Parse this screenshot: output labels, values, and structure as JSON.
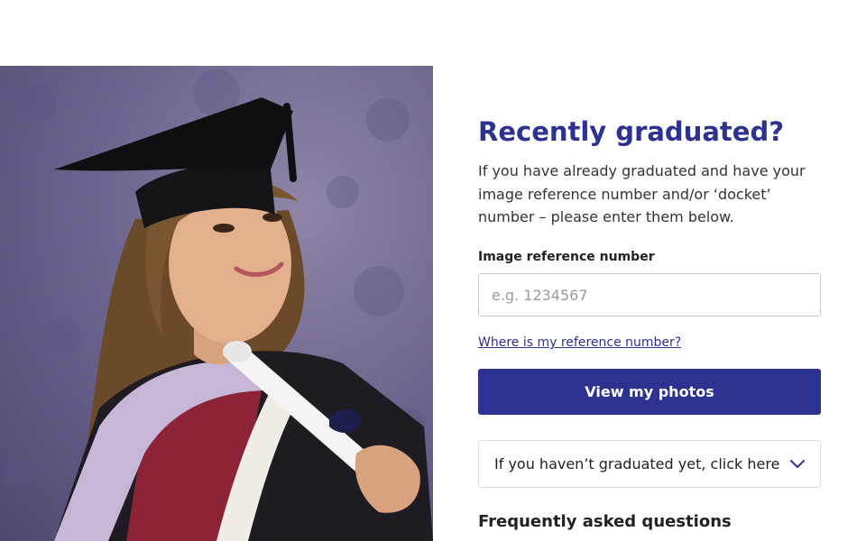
{
  "hero": {
    "image_alt": "Graduate in cap and gown holding a scroll"
  },
  "panel": {
    "title": "Recently graduated?",
    "intro": "If you have already graduated and have your image reference number and/or ‘docket’ number – please enter them below.",
    "field_label": "Image reference number",
    "field_value": "",
    "field_placeholder": "e.g. 1234567",
    "help_link": "Where is my reference number?",
    "submit_label": "View my photos",
    "accordion_label": "If you haven’t graduated yet, click here",
    "accordion_icon": "chevron-down-icon",
    "faq_heading": "Frequently asked questions"
  },
  "colors": {
    "brand": "#2d3190",
    "photo_background": "#6f6690"
  }
}
